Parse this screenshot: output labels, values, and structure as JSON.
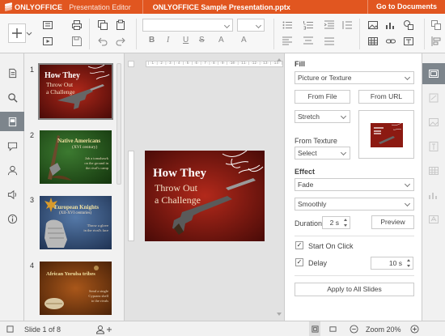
{
  "titlebar": {
    "brand": "ONLYOFFICE",
    "editor": "Presentation Editor",
    "document": "ONLYOFFICE Sample Presentation.pptx",
    "goto": "Go to Documents"
  },
  "slides": [
    {
      "num": "1",
      "title_l1": "How They",
      "title_l2": "Throw Out",
      "title_l3": "a Challenge"
    },
    {
      "num": "2",
      "title": "Native Americans",
      "subtitle": "(XVI century)",
      "note_l1": "Jab a tomahawk",
      "note_l2": "on the ground in",
      "note_l3": "the rival's camp"
    },
    {
      "num": "3",
      "title": "European Knights",
      "subtitle": "(XII-XVI centuries)",
      "note_l1": "Throw a glove",
      "note_l2": "in the rival's face"
    },
    {
      "num": "4",
      "title": "African Yoruba tribes",
      "note_l1": "Send a single",
      "note_l2": "Cypraea shell",
      "note_l3": "to the rivals"
    }
  ],
  "main_slide": {
    "title_l1": "How They",
    "title_l2": "Throw Out",
    "title_l3": "a Challenge"
  },
  "ruler_text": "|·1·|·2·|·3·|·4·|·5·|·6·|·7·|·8·|·9·|·10·|·11·|·12·|·13·|·14·|·15·|·16·|·17·|·18·|·19·|",
  "panel": {
    "fill_label": "Fill",
    "fill_type": "Picture or Texture",
    "from_file": "From File",
    "from_url": "From URL",
    "stretch": "Stretch",
    "from_texture_label": "From Texture",
    "select": "Select",
    "effect_label": "Effect",
    "effect_value": "Fade",
    "effect_sub": "Smoothly",
    "duration_label": "Duration",
    "duration_value": "2 s",
    "preview": "Preview",
    "start_on_click": "Start On Click",
    "delay_label": "Delay",
    "delay_value": "10 s",
    "apply_all": "Apply to All Slides",
    "check_mark": "✓"
  },
  "statusbar": {
    "slide_of": "Slide 1 of 8",
    "zoom": "Zoom 20%"
  },
  "colors": {
    "accent": "#e15620",
    "slide_red": "#8c1a12",
    "slide_green": "#2f6b2a",
    "slide_blue": "#3a5a86",
    "slide_brown": "#7a3a10"
  }
}
